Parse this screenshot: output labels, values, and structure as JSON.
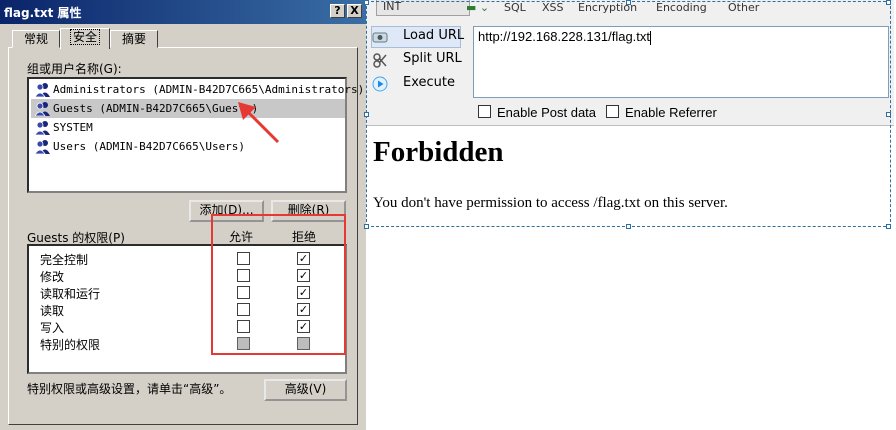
{
  "dialog": {
    "title": "flag.txt 属性",
    "help_button": "?",
    "close_button": "X",
    "tabs": [
      "常规",
      "安全",
      "摘要"
    ],
    "active_tab": "安全",
    "group_label": "组或用户名称(G):",
    "users": [
      {
        "name": "Administrators (ADMIN-B42D7C665\\Administrators)",
        "selected": false
      },
      {
        "name": "Guests (ADMIN-B42D7C665\\Guests)",
        "selected": true
      },
      {
        "name": "SYSTEM",
        "selected": false
      },
      {
        "name": "Users (ADMIN-B42D7C665\\Users)",
        "selected": false
      }
    ],
    "add_button": "添加(D)...",
    "remove_button": "删除(R)",
    "permissions_title": "Guests 的权限(P)",
    "allow_header": "允许",
    "deny_header": "拒绝",
    "permissions": [
      {
        "name": "完全控制",
        "allow": "unchecked",
        "deny": "checked"
      },
      {
        "name": "修改",
        "allow": "unchecked",
        "deny": "checked"
      },
      {
        "name": "读取和运行",
        "allow": "unchecked",
        "deny": "checked"
      },
      {
        "name": "读取",
        "allow": "unchecked",
        "deny": "checked"
      },
      {
        "name": "写入",
        "allow": "unchecked",
        "deny": "checked"
      },
      {
        "name": "特别的权限",
        "allow": "greyed",
        "deny": "greyed"
      }
    ],
    "advanced_hint": "特别权限或高级设置，请单击“高级”。",
    "advanced_button": "高级(V)"
  },
  "hackbar": {
    "top_menu": {
      "dropdown": "INT",
      "items": [
        "SQL",
        "XSS",
        "Encryption",
        "Encoding",
        "Other"
      ]
    },
    "actions": [
      "Load URL",
      "Split URL",
      "Execute"
    ],
    "url": "http://192.168.228.131/flag.txt",
    "options": [
      "Enable Post data",
      "Enable Referrer"
    ]
  },
  "page": {
    "heading": "Forbidden",
    "message": "You don't have permission to access /flag.txt on this server."
  },
  "colors": {
    "annotation_red": "#e53935",
    "titlebar": "#0a246a",
    "dialog_bg": "#d4d0c8"
  }
}
